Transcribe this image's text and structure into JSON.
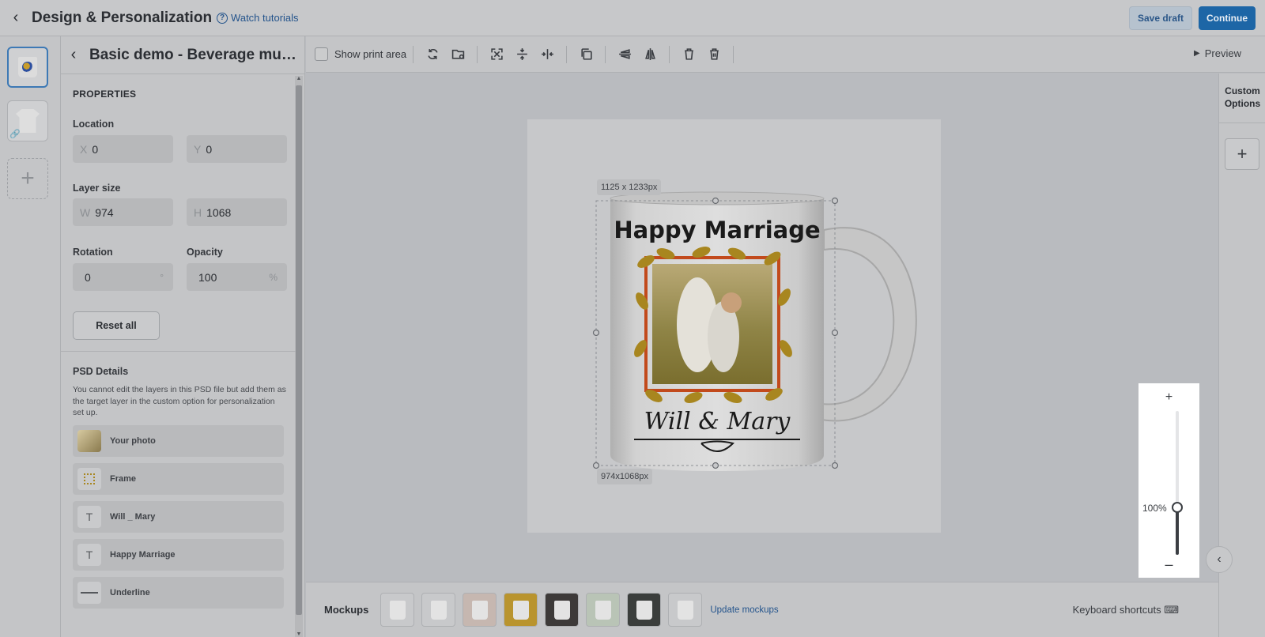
{
  "topbar": {
    "title": "Design & Personalization",
    "watch_label": "Watch tutorials",
    "save_draft": "Save draft",
    "continue": "Continue"
  },
  "panel": {
    "title": "Basic demo - Beverage mug t…",
    "properties_heading": "PROPERTIES",
    "location_label": "Location",
    "x_prefix": "X",
    "x_value": "0",
    "y_prefix": "Y",
    "y_value": "0",
    "layer_size_label": "Layer size",
    "w_prefix": "W",
    "w_value": "974",
    "h_prefix": "H",
    "h_value": "1068",
    "rotation_label": "Rotation",
    "rotation_value": "0",
    "rotation_unit": "°",
    "opacity_label": "Opacity",
    "opacity_value": "100",
    "opacity_unit": "%",
    "reset_label": "Reset all",
    "psd_heading": "PSD Details",
    "psd_note": "You cannot edit the layers in this PSD file but add them as the target layer in the custom option for personalization set up.",
    "layers": [
      {
        "name": "Your photo",
        "icon": "photo-icon"
      },
      {
        "name": "Frame",
        "icon": "frame-icon"
      },
      {
        "name": "Will _ Mary",
        "icon": "text-icon"
      },
      {
        "name": "Happy Marriage",
        "icon": "text-icon"
      },
      {
        "name": "Underline",
        "icon": "underline-icon"
      }
    ]
  },
  "toolbar": {
    "show_print_area": "Show print area",
    "preview": "Preview"
  },
  "canvas": {
    "dim_top": "1125 x 1233px",
    "dim_bottom": "974x1068px",
    "mug_headline": "Happy Marriage",
    "mug_names": "Will & Mary"
  },
  "right_rail": {
    "custom_options": "Custom Options"
  },
  "zoom": {
    "label": "100%",
    "level": 0.33
  },
  "mockups": {
    "label": "Mockups",
    "update_label": "Update mockups",
    "keyboard_label": "Keyboard shortcuts",
    "thumbs": [
      "#c8c9cb",
      "#c8c9cb",
      "#c6b7b0",
      "#b9942e",
      "#3d3a39",
      "#b9c4b6",
      "#3b3e3c",
      "#c8c9cb"
    ]
  },
  "colors": {
    "accent": "#1d66a6",
    "link": "#24548c",
    "frame_border": "#c24a1c",
    "leaf": "#a8861f"
  }
}
